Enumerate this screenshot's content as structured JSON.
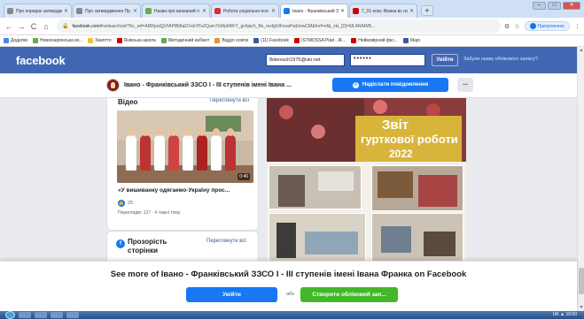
{
  "browser": {
    "tabs": [
      {
        "title": "Про порядок затвердж",
        "color": "#888888"
      },
      {
        "title": "Про затвердження Пр",
        "color": "#888888"
      },
      {
        "title": "Назва про визнаний п",
        "color": "#6aa84f"
      },
      {
        "title": "Робота соціально-пси",
        "color": "#cc3333"
      },
      {
        "title": "Івано - Франківський З",
        "color": "#1877f2"
      },
      {
        "title": "7_01 клас Фізика вс на",
        "color": "#cc0000"
      }
    ],
    "close_glyph": "✕",
    "new_tab_glyph": "+",
    "url_host": "facebook.com",
    "url_rest": "/frankaschool/?hc_ref=ARRpoiQjVIAPtBi9aD1nb7PsZQum7nWp6RFY_gvhjach_Bs_mxfgUtFevaHuEmwCM&fref=nf&_xts_[0]=68.ARAIM5...",
    "paused_label": "Призупинено",
    "bookmarks": [
      {
        "label": "Додатки",
        "color": "#4a86e8"
      },
      {
        "label": "Новоозерянська мі...",
        "color": "#6aa84f"
      },
      {
        "label": "Заняття",
        "color": "#f1c232"
      },
      {
        "label": "Янівська школа",
        "color": "#cc0000"
      },
      {
        "label": "Методичний кабінет",
        "color": "#6aa84f"
      },
      {
        "label": "Відділ освіти",
        "color": "#e69138"
      },
      {
        "label": "(11) Facebook",
        "color": "#3b5998"
      },
      {
        "label": "ISTMOSSA Plad - Ж...",
        "color": "#cc0000"
      },
      {
        "label": "Неймовірний фкс...",
        "color": "#cc0000"
      },
      {
        "label": "Mapi",
        "color": "#3b5998"
      }
    ]
  },
  "fb": {
    "logo": "facebook",
    "email_value": "8skevuch1975@ukr.net",
    "password_mask": "••••••",
    "login_label": "Увійти",
    "forgot_label": "Забули назву облікового запису?"
  },
  "page": {
    "name": "Івано - Франківський ЗЗСО І - ІІІ ступенів імені Івана ...",
    "message_label": "Надіслати повідомлення",
    "more_label": "..."
  },
  "videos": {
    "title": "Відео",
    "see_all": "Переглянути всі",
    "duration": "0:46",
    "video_title": "«У вишиванку одягаемо-Україну прос...",
    "likes": "25",
    "views": "Переглядів: 127 · 4 тижні тому"
  },
  "transparency": {
    "title": "Прозорість сторінки",
    "see_all": "Переглянути всі",
    "icon_text": "f"
  },
  "post_image": {
    "line1": "Звіт",
    "line2": "гурткової роботи",
    "line3": "2022"
  },
  "overlay": {
    "text": "See more of Івано - Франківський ЗЗСО І - ІІІ ступенів імені Івана Франка on Facebook",
    "login_label": "Увійти",
    "or_label": "або",
    "create_label": "Створити обліковий зап..."
  },
  "taskbar": {
    "tray_text": "UK  ▲  10:00"
  }
}
